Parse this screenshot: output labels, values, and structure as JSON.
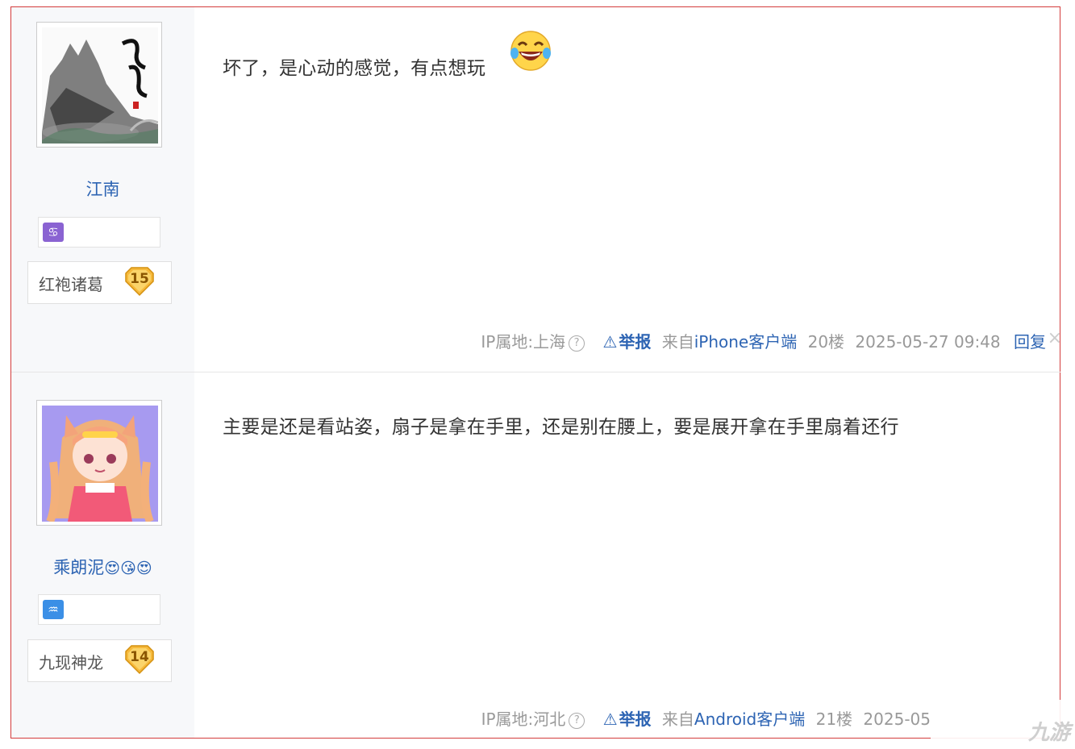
{
  "posts": [
    {
      "username": "江南",
      "zodiac_icon": "cancer-icon",
      "zodiac_color": "#8a63d2",
      "zodiac_glyph": "♋",
      "badge_name": "红袍诸葛",
      "badge_level": "15",
      "content": "坏了，是心动的感觉，有点想玩",
      "emoji": "laughing-tears-emoji",
      "ip_location": "IP属地:上海",
      "report_label": "举报",
      "client_prefix": "来自",
      "client_name": "iPhone客户端",
      "floor": "20楼",
      "timestamp": "2025-05-27 09:48",
      "reply_label": "回复"
    },
    {
      "username": "乘朗泥",
      "username_emojis": "😍😘😍",
      "zodiac_icon": "aquarius-icon",
      "zodiac_color": "#3b8fe6",
      "zodiac_glyph": "♒",
      "badge_name": "九现神龙",
      "badge_level": "14",
      "content": "主要是还是看站姿，扇子是拿在手里，还是别在腰上，要是展开拿在手里扇着还行",
      "ip_location": "IP属地:河北",
      "report_label": "举报",
      "client_prefix": "来自",
      "client_name": "Android客户端",
      "floor": "21楼",
      "timestamp": "2025-05"
    }
  ],
  "watermark": "九游",
  "colors": {
    "link": "#2d64b3",
    "frame": "#d43c3c",
    "sidebar": "#f7f8fa"
  }
}
